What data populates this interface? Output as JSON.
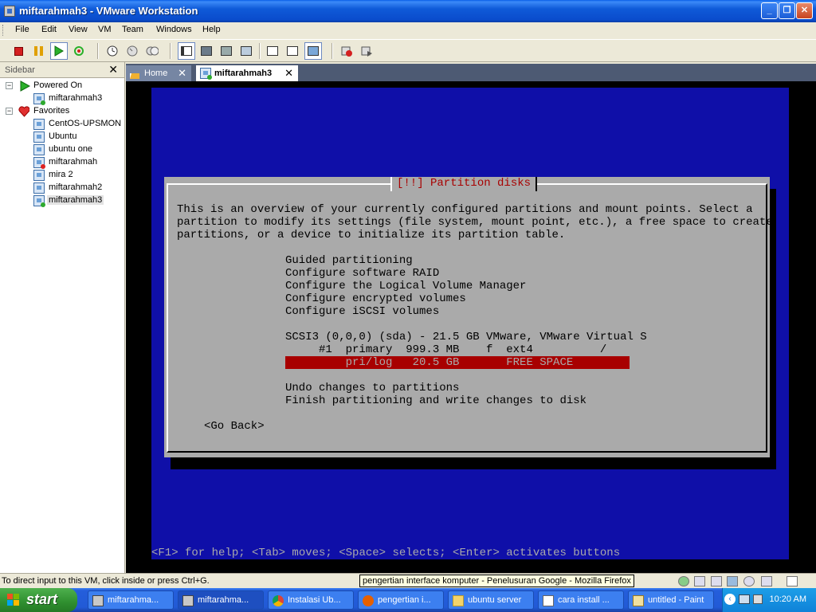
{
  "window": {
    "title": "miftarahmah3 - VMware Workstation",
    "minimize": "_",
    "restore": "❐",
    "close": "✕"
  },
  "menu": [
    "File",
    "Edit",
    "View",
    "VM",
    "Team",
    "Windows",
    "Help"
  ],
  "sidebar": {
    "title": "Sidebar",
    "close": "✕",
    "groups": [
      {
        "label": "Powered On",
        "expander": "−",
        "items": [
          "miftarahmah3"
        ]
      },
      {
        "label": "Favorites",
        "expander": "−",
        "items": [
          "CentOS-UPSMON",
          "Ubuntu",
          "ubuntu one",
          "miftarahmah",
          "mira 2",
          "miftarahmah2",
          "miftarahmah3"
        ]
      }
    ]
  },
  "tabs": [
    {
      "label": "Home",
      "close": "✕"
    },
    {
      "label": "miftarahmah3",
      "close": "✕"
    }
  ],
  "installer": {
    "dialog_title": "[!!] Partition disks",
    "intro": [
      "This is an overview of your currently configured partitions and mount points. Select a",
      "partition to modify its settings (file system, mount point, etc.), a free space to create",
      "partitions, or a device to initialize its partition table."
    ],
    "options": [
      "Guided partitioning",
      "Configure software RAID",
      "Configure the Logical Volume Manager",
      "Configure encrypted volumes",
      "Configure iSCSI volumes"
    ],
    "disk": "SCSI3 (0,0,0) (sda) - 21.5 GB VMware, VMware Virtual S",
    "partition_1": "     #1  primary  999.3 MB    f  ext4          /",
    "free_space": "         pri/log   20.5 GB       FREE SPACE",
    "undo": "Undo changes to partitions",
    "finish": "Finish partitioning and write changes to disk",
    "go_back": "<Go Back>",
    "help_line": "<F1> for help; <Tab> moves; <Space> selects; <Enter> activates buttons"
  },
  "status": {
    "text": "To direct input to this VM, click inside or press Ctrl+G.",
    "tooltip": "pengertian interface komputer - Penelusuran Google - Mozilla Firefox"
  },
  "taskbar": {
    "start": "start",
    "items": [
      "miftarahma...",
      "miftarahma...",
      "Instalasi Ub...",
      "pengertian i...",
      "ubuntu server",
      "cara install ...",
      "untitled - Paint"
    ],
    "clock": "10:20 AM"
  },
  "colors": {
    "installer_bg": "#0f0fa8",
    "dialog_bg": "#aaaaaa",
    "highlight": "#a80000"
  }
}
